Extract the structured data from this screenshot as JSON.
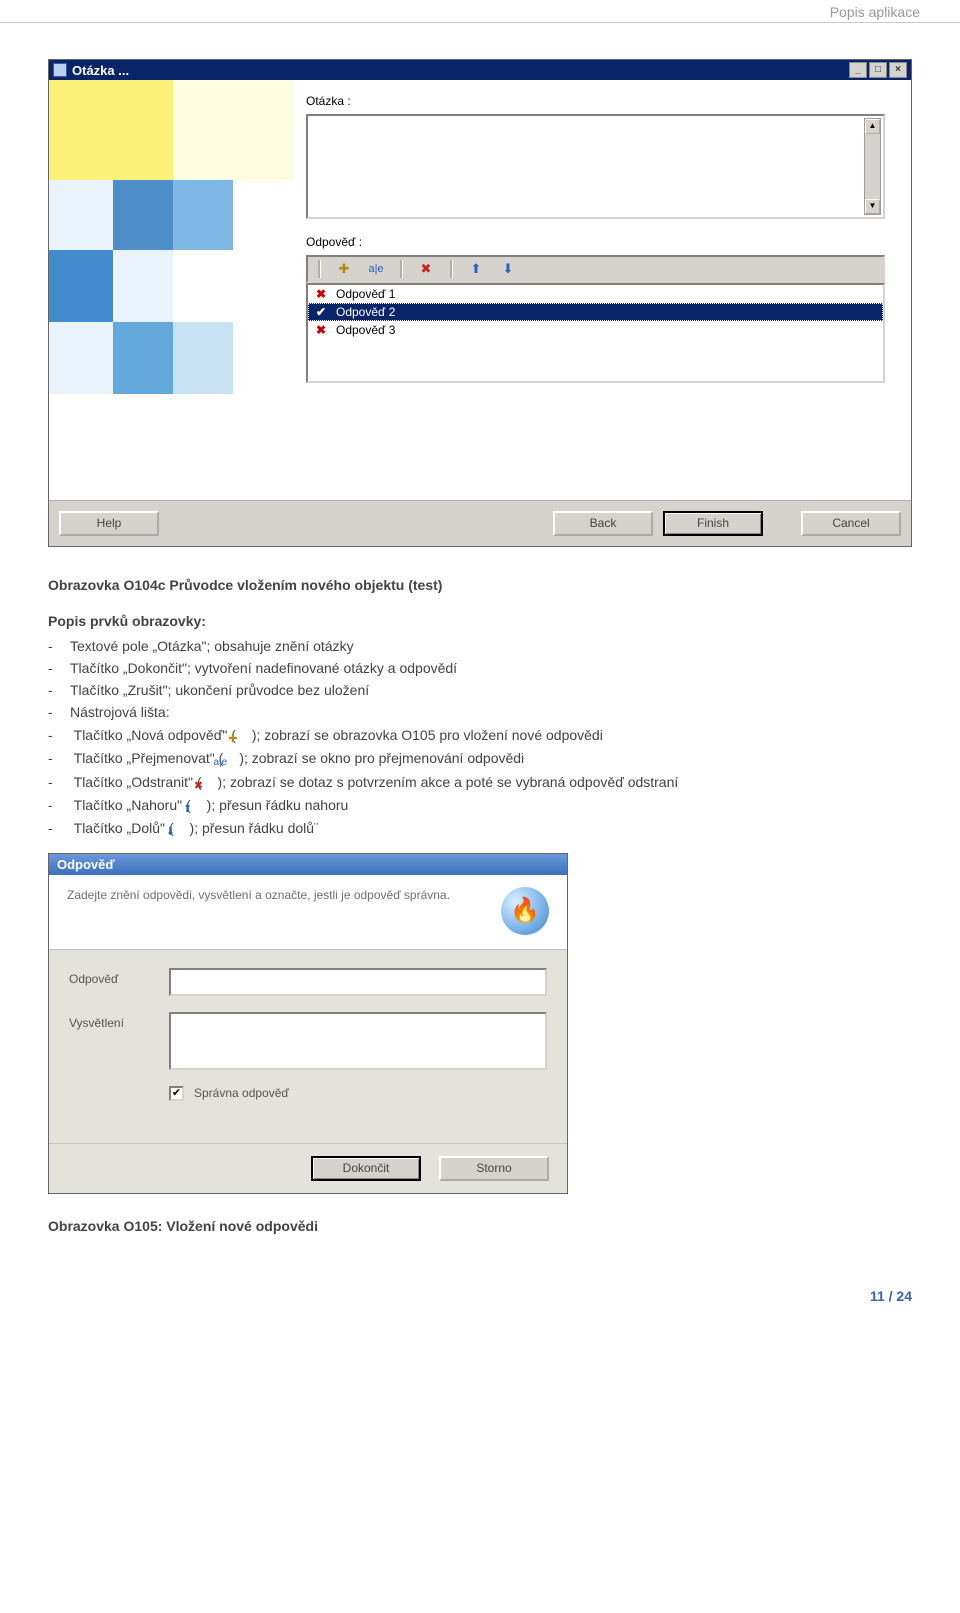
{
  "page": {
    "header": "Popis aplikace",
    "number": "11 / 24"
  },
  "win1": {
    "title": "Otázka ...",
    "question_label": "Otázka :",
    "answers_label": "Odpověď :",
    "answers": [
      "Odpověď 1",
      "Odpověď 2",
      "Odpověď 3"
    ],
    "selected_index": 1,
    "buttons": {
      "help": "Help",
      "back": "Back",
      "finish": "Finish",
      "cancel": "Cancel"
    }
  },
  "desc": {
    "figure_title": "Obrazovka O104c Průvodce vložením nového objektu (test)",
    "subhead": "Popis prvků obrazovky:",
    "items": [
      "Textové pole „Otázka\"; obsahuje znění otázky",
      "Tlačítko „Dokončit\"; vytvoření nadefinované otázky a odpovědí",
      "Tlačítko „Zrušit\"; ukončení průvodce bez uložení",
      "Nástrojová lišta:"
    ],
    "sub_items": [
      {
        "pre": "Tlačítko „Nová odpověď\" (",
        "icon": "new",
        "post": "); zobrazí se obrazovka O105 pro vložení nové odpovědi"
      },
      {
        "pre": "Tlačítko „Přejmenovat\" (",
        "icon": "rename",
        "post": "); zobrazí se okno pro přejmenování odpovědi"
      },
      {
        "pre": "Tlačítko „Odstranit\" (",
        "icon": "delete",
        "post": "); zobrazí se dotaz s potvrzením akce a poté se vybraná odpověď odstraní"
      },
      {
        "pre": "Tlačítko „Nahoru\" (",
        "icon": "up",
        "post": "); přesun řádku nahoru"
      },
      {
        "pre": "Tlačítko „Dolů\" (",
        "icon": "down",
        "post": "); přesun řádku dolů¨"
      }
    ]
  },
  "dlg": {
    "title": "Odpověď",
    "hint": "Zadejte znění odpovědi, vysvětlení a označte, jestli je odpověď správna.",
    "field_answer": "Odpověď",
    "field_expl": "Vysvětlení",
    "checkbox": "Správna odpověď",
    "checked": true,
    "buttons": {
      "ok": "Dokončit",
      "cancel": "Storno"
    }
  },
  "figure2_title": "Obrazovka O105: Vložení nové odpovědi"
}
